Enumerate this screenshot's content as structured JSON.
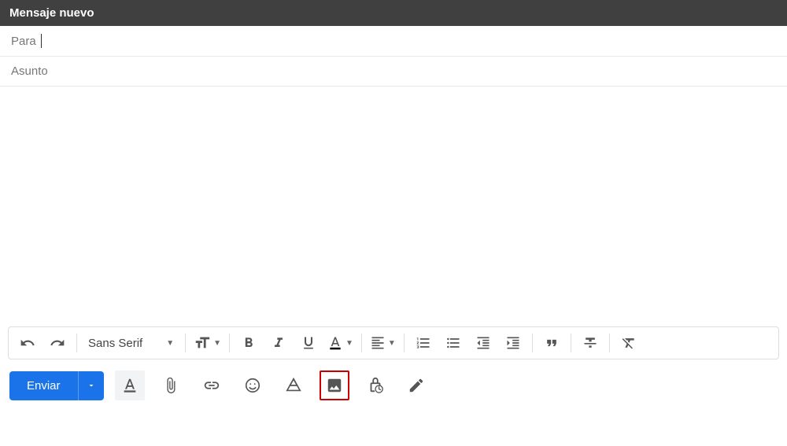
{
  "header": {
    "title": "Mensaje nuevo"
  },
  "fields": {
    "to_label": "Para",
    "to_value": "",
    "subject_placeholder": "Asunto",
    "subject_value": ""
  },
  "format_toolbar": {
    "font_name": "Sans Serif"
  },
  "actions": {
    "send_label": "Enviar"
  },
  "icons": {
    "undo": "undo-icon",
    "redo": "redo-icon",
    "font_size": "font-size-icon",
    "bold": "bold-icon",
    "italic": "italic-icon",
    "underline": "underline-icon",
    "text_color": "text-color-icon",
    "align": "align-icon",
    "list_numbered": "numbered-list-icon",
    "list_bulleted": "bulleted-list-icon",
    "indent_decrease": "indent-decrease-icon",
    "indent_increase": "indent-increase-icon",
    "quote": "quote-icon",
    "strikethrough": "strikethrough-icon",
    "remove_format": "remove-format-icon",
    "formatting": "text-format-icon",
    "attach": "attachment-icon",
    "link": "link-icon",
    "emoji": "emoji-icon",
    "drive": "drive-icon",
    "image": "image-icon",
    "confidential": "confidential-icon",
    "signature": "pen-icon"
  }
}
